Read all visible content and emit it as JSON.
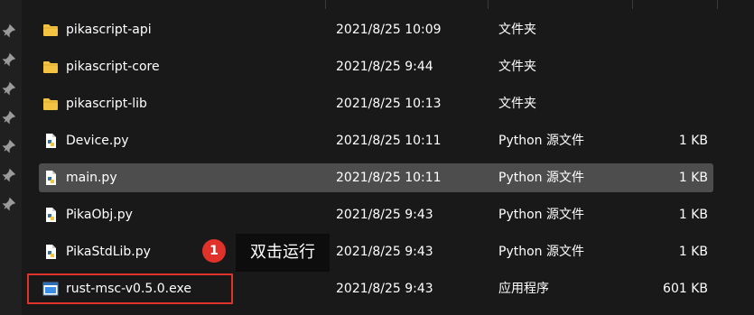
{
  "files": [
    {
      "name": "pikascript-api",
      "date": "2021/8/25 10:09",
      "type": "文件夹",
      "size": "",
      "icon": "folder-icon"
    },
    {
      "name": "pikascript-core",
      "date": "2021/8/25 9:44",
      "type": "文件夹",
      "size": "",
      "icon": "folder-icon"
    },
    {
      "name": "pikascript-lib",
      "date": "2021/8/25 10:13",
      "type": "文件夹",
      "size": "",
      "icon": "folder-icon"
    },
    {
      "name": "Device.py",
      "date": "2021/8/25 10:11",
      "type": "Python 源文件",
      "size": "1 KB",
      "icon": "python-file-icon"
    },
    {
      "name": "main.py",
      "date": "2021/8/25 10:11",
      "type": "Python 源文件",
      "size": "1 KB",
      "icon": "python-file-icon",
      "selected": true
    },
    {
      "name": "PikaObj.py",
      "date": "2021/8/25 9:43",
      "type": "Python 源文件",
      "size": "1 KB",
      "icon": "python-file-icon"
    },
    {
      "name": "PikaStdLib.py",
      "date": "2021/8/25 9:43",
      "type": "Python 源文件",
      "size": "1 KB",
      "icon": "python-file-icon"
    },
    {
      "name": "rust-msc-v0.5.0.exe",
      "date": "2021/8/25 9:43",
      "type": "应用程序",
      "size": "601 KB",
      "icon": "exe-file-icon"
    }
  ],
  "annotation": {
    "badge": "1",
    "tooltip": "双击运行"
  },
  "colors": {
    "background": "#191919",
    "selected_row": "#4d4d4d",
    "annotation_red": "#e0322a",
    "folder": "#f5c342"
  },
  "sidebar": {
    "icons": [
      "pin-icon",
      "pin-icon",
      "pin-icon",
      "pin-icon",
      "pin-icon",
      "pin-icon",
      "pin-icon"
    ]
  }
}
